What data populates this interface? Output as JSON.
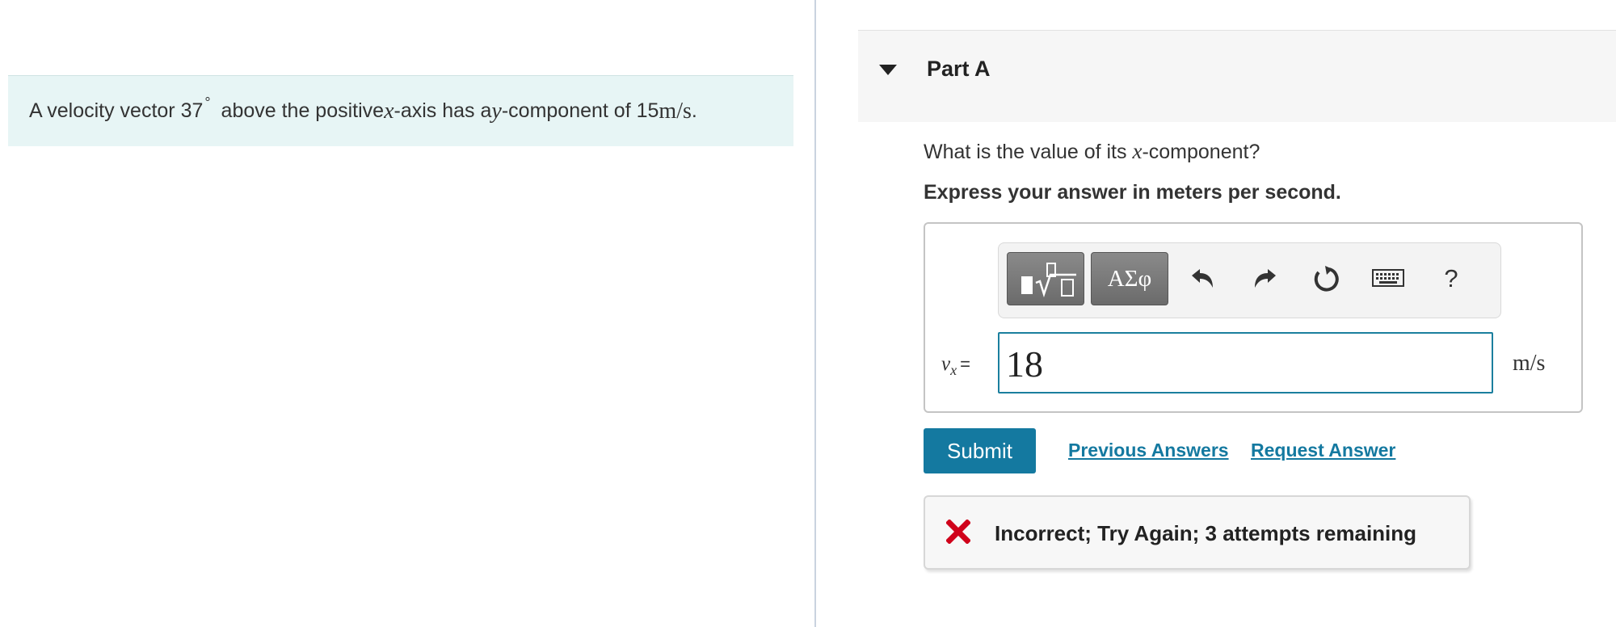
{
  "problem": {
    "text_before_angle": "A velocity vector 37",
    "degree_symbol": "°",
    "text_middle_1": "above the positive ",
    "x_var": "x",
    "text_middle_2": "-axis has a ",
    "y_var": "y",
    "text_middle_3": "-component of 15 ",
    "unit": "m/s",
    "text_end": "."
  },
  "part": {
    "title": "Part A",
    "question_before": "What is the value of its ",
    "question_var": "x",
    "question_after": "-component?",
    "instruction": "Express your answer in meters per second."
  },
  "toolbar": {
    "templates_icon": "templates-icon",
    "symbols_label": "ΑΣφ",
    "undo_icon": "undo-icon",
    "redo_icon": "redo-icon",
    "reset_icon": "reset-icon",
    "keyboard_icon": "keyboard-icon",
    "help_label": "?"
  },
  "answer": {
    "variable": "v",
    "subscript": "x",
    "equals": "=",
    "value": "18",
    "unit": "m/s"
  },
  "actions": {
    "submit": "Submit",
    "previous_answers": "Previous Answers",
    "request_answer": "Request Answer"
  },
  "feedback": {
    "text": "Incorrect; Try Again; 3 attempts remaining",
    "icon": "x-icon"
  },
  "colors": {
    "accent": "#1479a0",
    "problem_bg": "#e7f5f5",
    "error": "#d0021b"
  }
}
